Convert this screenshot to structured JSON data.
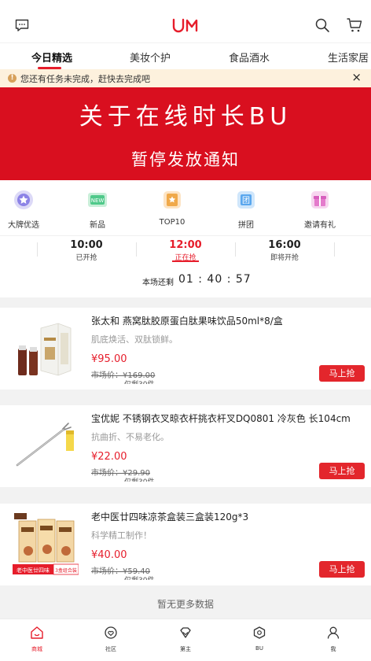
{
  "brand": {
    "accent": "#e61d2b",
    "banner_bg": "#d90f1f"
  },
  "header": {
    "logo_icon": "um-logo",
    "left_icon": "message-icon",
    "right_icons": [
      "search-icon",
      "cart-icon"
    ]
  },
  "tabs": [
    {
      "label": "今日精选",
      "active": true
    },
    {
      "label": "美妆个护",
      "active": false
    },
    {
      "label": "食品酒水",
      "active": false
    },
    {
      "label": "生活家居",
      "active": false
    }
  ],
  "notice": {
    "text": "您还有任务未完成，赶快去完成吧",
    "close": "×"
  },
  "banner": {
    "line1": "关于在线时长BU",
    "line2": "暂停发放通知"
  },
  "categories": [
    {
      "label": "大牌优选",
      "icon": "star-badge-icon"
    },
    {
      "label": "新品",
      "icon": "new-tag-icon"
    },
    {
      "label": "TOP10",
      "icon": "top-badge-icon"
    },
    {
      "label": "拼团",
      "icon": "group-icon"
    },
    {
      "label": "邀请有礼",
      "icon": "gift-icon"
    }
  ],
  "time_slots": [
    {
      "time": "10:00",
      "status": "已开抢",
      "active": false
    },
    {
      "time": "12:00",
      "status": "正在抢",
      "active": true
    },
    {
      "time": "16:00",
      "status": "即将开抢",
      "active": false
    }
  ],
  "countdown": {
    "label": "本场还剩",
    "value": "01 : 40 : 57"
  },
  "products": [
    {
      "title": "张太和 燕窝肽胶原蛋白肽果味饮品50ml*8/盒",
      "subtitle": "肌底焕活、双肽锁鲜。",
      "price": "¥95.00",
      "original_price": "市场价：¥169.00",
      "remaining": "仅剩30件",
      "button": "马上抢",
      "image": "drink-box"
    },
    {
      "title": "宝优妮 不锈钢衣叉晾衣杆挑衣杆叉DQ0801 冷灰色 长104cm",
      "subtitle": "抗曲折、不易老化。",
      "price": "¥22.00",
      "original_price": "市场价：¥29.90",
      "remaining": "仅剩30件",
      "button": "马上抢",
      "image": "clothes-fork"
    },
    {
      "title": "老中医廿四味凉茶盒装三盒装120g*3",
      "subtitle": "科学精工制作！",
      "price": "¥40.00",
      "original_price": "市场价：¥59.40",
      "remaining": "仅剩30件",
      "button": "马上抢",
      "image": "tea-boxes",
      "image_caption": "老中医廿四味",
      "image_caption2": "3盒组合装"
    }
  ],
  "no_more": "暂无更多数据",
  "bottom_nav": [
    {
      "label": "商城",
      "icon": "home-icon",
      "active": true
    },
    {
      "label": "社区",
      "icon": "community-icon",
      "active": false
    },
    {
      "label": "第主",
      "icon": "diamond-icon",
      "active": false
    },
    {
      "label": "BU",
      "icon": "bu-icon",
      "active": false
    },
    {
      "label": "我",
      "icon": "user-icon",
      "active": false
    }
  ]
}
